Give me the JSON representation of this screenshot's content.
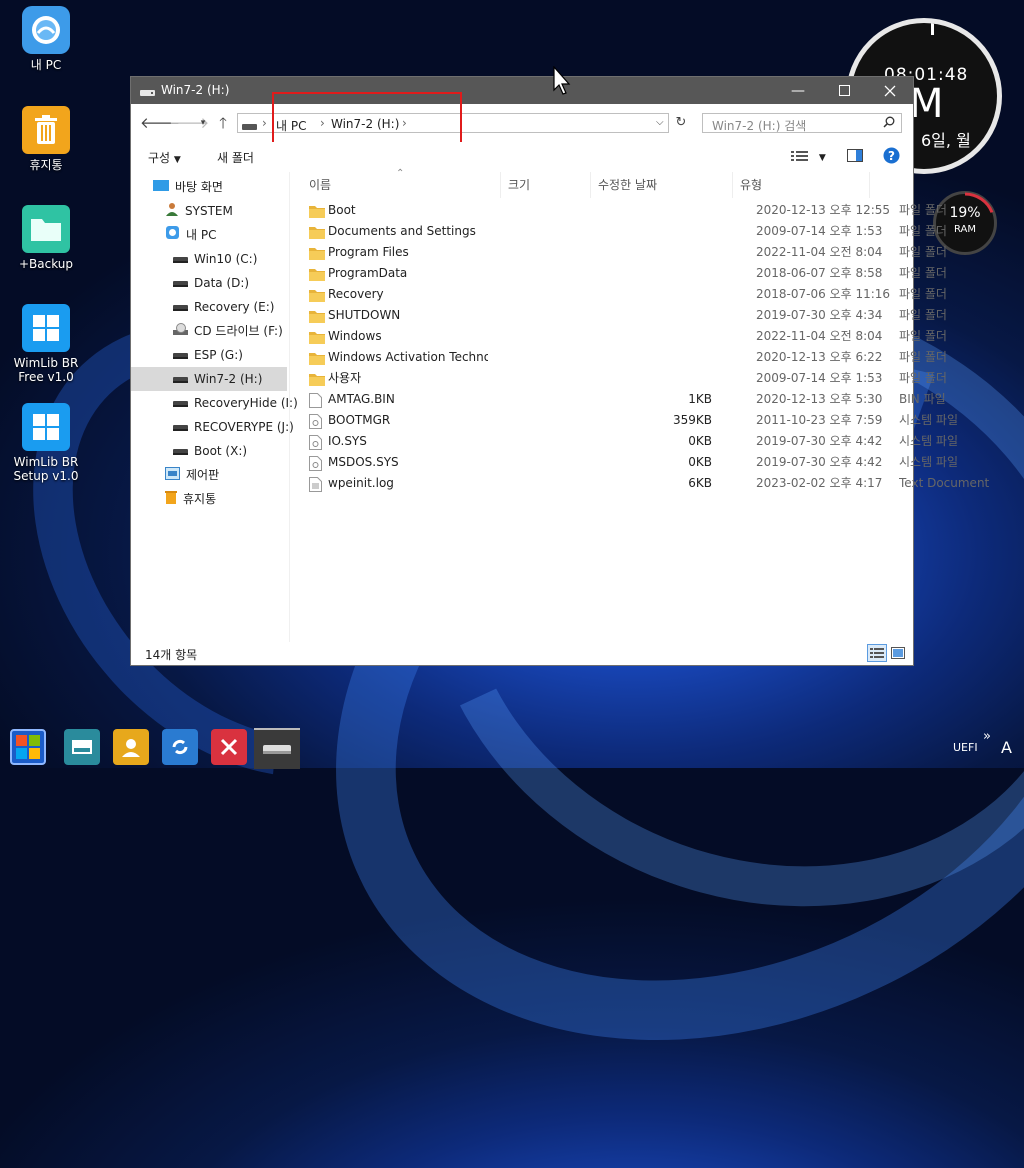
{
  "desktop": {
    "icons": [
      {
        "label": "내 PC"
      },
      {
        "label": "휴지통"
      },
      {
        "label": "+Backup"
      },
      {
        "label": "WimLib BR Free v1.0"
      },
      {
        "label": "WimLib BR Setup v1.0"
      }
    ]
  },
  "clock": {
    "time": "08:01:48",
    "ampm": "M",
    "date": "6일, 월"
  },
  "ram": {
    "percent": "19%",
    "label": "RAM",
    "fraction": 0.19
  },
  "window": {
    "title": "Win7-2 (H:)",
    "breadcrumb": [
      "내 PC",
      "Win7-2 (H:)"
    ],
    "search_placeholder": "Win7-2 (H:) 검색",
    "toolbar": {
      "organize": "구성",
      "new_folder": "새 폴더"
    },
    "status": "14개 항목",
    "highlight_color": "#e01b1b"
  },
  "nav": {
    "items": [
      {
        "label": "바탕 화면",
        "icon": "desktop-icon"
      },
      {
        "label": "SYSTEM",
        "icon": "user-icon"
      },
      {
        "label": "내 PC",
        "icon": "pc-icon"
      },
      {
        "label": "Win10 (C:)",
        "icon": "drive-icon"
      },
      {
        "label": "Data (D:)",
        "icon": "drive-icon"
      },
      {
        "label": "Recovery (E:)",
        "icon": "drive-icon"
      },
      {
        "label": "CD 드라이브 (F:)",
        "icon": "cd-icon"
      },
      {
        "label": "ESP (G:)",
        "icon": "drive-icon"
      },
      {
        "label": "Win7-2 (H:)",
        "icon": "drive-icon"
      },
      {
        "label": "RecoveryHide (I:)",
        "icon": "drive-icon"
      },
      {
        "label": "RECOVERYPE (J:)",
        "icon": "drive-icon"
      },
      {
        "label": "Boot (X:)",
        "icon": "drive-icon"
      },
      {
        "label": "제어판",
        "icon": "control-panel-icon"
      },
      {
        "label": "휴지통",
        "icon": "recycle-bin-icon"
      }
    ]
  },
  "columns": {
    "name": "이름",
    "size": "크기",
    "date": "수정한 날짜",
    "type": "유형"
  },
  "files": [
    {
      "name": "Boot",
      "size": "",
      "date": "2020-12-13 오후 12:55",
      "type": "파일 폴더",
      "icon": "folder-icon"
    },
    {
      "name": "Documents and Settings",
      "size": "",
      "date": "2009-07-14 오후 1:53",
      "type": "파일 폴더",
      "icon": "folder-icon"
    },
    {
      "name": "Program Files",
      "size": "",
      "date": "2022-11-04 오전 8:04",
      "type": "파일 폴더",
      "icon": "folder-icon"
    },
    {
      "name": "ProgramData",
      "size": "",
      "date": "2018-06-07 오후 8:58",
      "type": "파일 폴더",
      "icon": "folder-icon"
    },
    {
      "name": "Recovery",
      "size": "",
      "date": "2018-07-06 오후 11:16",
      "type": "파일 폴더",
      "icon": "folder-icon"
    },
    {
      "name": "SHUTDOWN",
      "size": "",
      "date": "2019-07-30 오후 4:34",
      "type": "파일 폴더",
      "icon": "folder-icon"
    },
    {
      "name": "Windows",
      "size": "",
      "date": "2022-11-04 오전 8:04",
      "type": "파일 폴더",
      "icon": "folder-icon"
    },
    {
      "name": "Windows Activation Technol...",
      "size": "",
      "date": "2020-12-13 오후 6:22",
      "type": "파일 폴더",
      "icon": "folder-icon"
    },
    {
      "name": "사용자",
      "size": "",
      "date": "2009-07-14 오후 1:53",
      "type": "파일 폴더",
      "icon": "folder-icon"
    },
    {
      "name": "AMTAG.BIN",
      "size": "1KB",
      "date": "2020-12-13 오후 5:30",
      "type": "BIN 파일",
      "icon": "file-icon"
    },
    {
      "name": "BOOTMGR",
      "size": "359KB",
      "date": "2011-10-23 오후 7:59",
      "type": "시스템 파일",
      "icon": "system-file-icon"
    },
    {
      "name": "IO.SYS",
      "size": "0KB",
      "date": "2019-07-30 오후 4:42",
      "type": "시스템 파일",
      "icon": "system-file-icon"
    },
    {
      "name": "MSDOS.SYS",
      "size": "0KB",
      "date": "2019-07-30 오후 4:42",
      "type": "시스템 파일",
      "icon": "system-file-icon"
    },
    {
      "name": "wpeinit.log",
      "size": "6KB",
      "date": "2023-02-02 오후 4:17",
      "type": "Text Document",
      "icon": "text-file-icon"
    }
  ],
  "taskbar": {
    "apps": [
      {
        "name": "start-button",
        "color": "#1b5cc8"
      },
      {
        "name": "drive-app",
        "color": "#2a8b9c"
      },
      {
        "name": "user-app",
        "color": "#e7a81c"
      },
      {
        "name": "sync-app",
        "color": "#2a7bd1"
      },
      {
        "name": "x-app",
        "color": "#d9323f"
      },
      {
        "name": "explorer-app",
        "color": "#3a3a3a"
      }
    ],
    "tray_label": "UEFI",
    "tray_chevron": "»",
    "ime": "A"
  }
}
